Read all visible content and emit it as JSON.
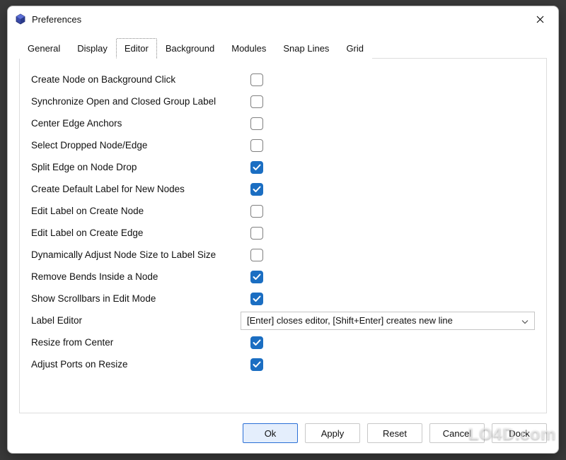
{
  "window": {
    "title": "Preferences"
  },
  "tabs": [
    {
      "label": "General",
      "selected": false
    },
    {
      "label": "Display",
      "selected": false
    },
    {
      "label": "Editor",
      "selected": true
    },
    {
      "label": "Background",
      "selected": false
    },
    {
      "label": "Modules",
      "selected": false
    },
    {
      "label": "Snap Lines",
      "selected": false
    },
    {
      "label": "Grid",
      "selected": false
    }
  ],
  "options": [
    {
      "label": "Create Node on Background Click",
      "checked": false
    },
    {
      "label": "Synchronize Open and Closed Group Label",
      "checked": false
    },
    {
      "label": "Center Edge Anchors",
      "checked": false
    },
    {
      "label": "Select Dropped Node/Edge",
      "checked": false
    },
    {
      "label": "Split Edge on Node Drop",
      "checked": true
    },
    {
      "label": "Create Default Label for New Nodes",
      "checked": true
    },
    {
      "label": "Edit Label on Create Node",
      "checked": false
    },
    {
      "label": "Edit Label on Create Edge",
      "checked": false
    },
    {
      "label": "Dynamically Adjust Node Size to Label Size",
      "checked": false
    },
    {
      "label": "Remove Bends Inside a Node",
      "checked": true
    },
    {
      "label": "Show Scrollbars in Edit Mode",
      "checked": true
    }
  ],
  "labelEditor": {
    "label": "Label Editor",
    "value": "[Enter] closes editor, [Shift+Enter] creates new line"
  },
  "options2": [
    {
      "label": "Resize from Center",
      "checked": true
    },
    {
      "label": "Adjust Ports on Resize",
      "checked": true
    }
  ],
  "buttons": {
    "ok": "Ok",
    "apply": "Apply",
    "reset": "Reset",
    "cancel": "Cancel",
    "dock": "Dock"
  },
  "watermark": "LO4D.com"
}
